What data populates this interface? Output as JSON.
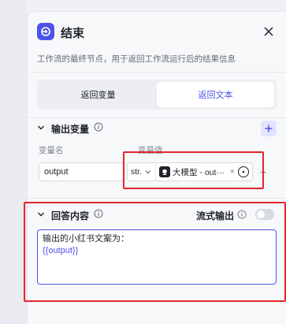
{
  "node": {
    "title": "结束",
    "description": "工作流的最终节点，用于返回工作流运行后的结果信息"
  },
  "tabs": [
    {
      "label": "返回变量",
      "active": false
    },
    {
      "label": "返回文本",
      "active": true
    }
  ],
  "output_section": {
    "title": "输出变量",
    "columns": {
      "name": "变量名",
      "value": "变量值"
    },
    "rows": [
      {
        "name": "output",
        "type": "str.",
        "reference": "大模型 - out···"
      }
    ]
  },
  "answer_section": {
    "title": "回答内容",
    "stream_label": "流式输出",
    "stream_enabled": false,
    "content_line1": "输出的小红书文案为：",
    "content_line2": "{{output}}"
  },
  "colors": {
    "accent": "#4d53e8",
    "highlight": "#e5252a"
  },
  "icons": {
    "node": "exit-icon",
    "close": "close-icon",
    "collapse": "chevron-down-icon",
    "info": "info-icon",
    "add": "plus-icon",
    "model": "model-icon",
    "reference": "variable-reference-icon",
    "remove": "minus-icon"
  }
}
